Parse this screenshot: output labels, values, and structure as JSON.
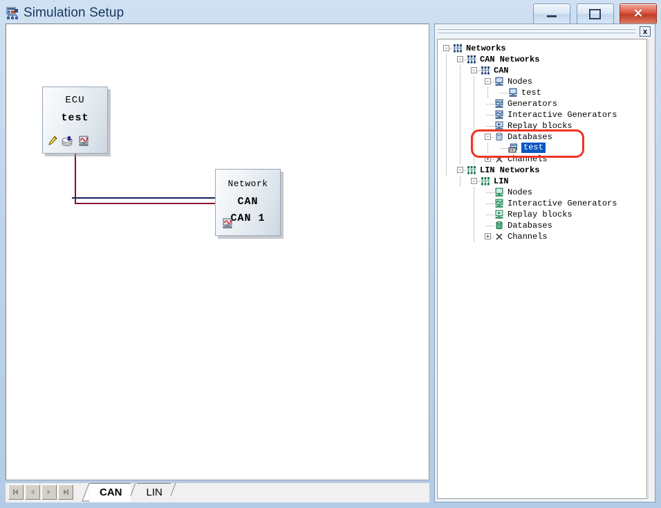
{
  "window": {
    "title": "Simulation Setup",
    "icon": "simulation-setup-icon",
    "minimize_label": "Minimize",
    "maximize_label": "Maximize",
    "close_label": "✕"
  },
  "canvas": {
    "blocks": [
      {
        "kind": "ecu",
        "line1": "ECU",
        "line2": "test",
        "icons": [
          "pencil-icon",
          "stack-icon",
          "measurement-icon"
        ]
      },
      {
        "kind": "network",
        "line1": "Network",
        "line2": "CAN",
        "line3": "CAN 1",
        "icons": [
          "measurement-icon"
        ]
      }
    ],
    "wire_colors": {
      "bus": "#8c0a33",
      "signal": "#11225e"
    }
  },
  "tabstrip": {
    "nav_buttons": [
      "first-record-button",
      "previous-record-button",
      "next-record-button",
      "last-record-button"
    ],
    "tabs": [
      {
        "label": "CAN",
        "active": true
      },
      {
        "label": "LIN",
        "active": false
      }
    ]
  },
  "dock": {
    "close_label": "x",
    "scrollbar": "vertical-scrollbar",
    "tree": [
      {
        "label": "Networks",
        "depth": 0,
        "expander": "-",
        "icon": "network-icon",
        "bold": true,
        "selected": false
      },
      {
        "label": "CAN Networks",
        "depth": 1,
        "expander": "-",
        "icon": "network-icon",
        "bold": true,
        "selected": false
      },
      {
        "label": "CAN",
        "depth": 2,
        "expander": "-",
        "icon": "network-icon",
        "bold": true,
        "selected": false
      },
      {
        "label": "Nodes",
        "depth": 3,
        "expander": "-",
        "icon": "node-icon",
        "bold": false,
        "selected": false
      },
      {
        "label": "test",
        "depth": 4,
        "expander": "",
        "icon": "node-icon",
        "bold": false,
        "selected": false
      },
      {
        "label": "Generators",
        "depth": 3,
        "expander": "",
        "icon": "generator-icon",
        "bold": false,
        "selected": false
      },
      {
        "label": "Interactive Generators",
        "depth": 3,
        "expander": "",
        "icon": "generator-icon",
        "bold": false,
        "selected": false
      },
      {
        "label": "Replay blocks",
        "depth": 3,
        "expander": "",
        "icon": "replay-icon",
        "bold": false,
        "selected": false
      },
      {
        "label": "Databases",
        "depth": 3,
        "expander": "-",
        "icon": "database-icon",
        "bold": false,
        "selected": false
      },
      {
        "label": "test",
        "depth": 4,
        "expander": "",
        "icon": "dbc-icon",
        "bold": false,
        "selected": true
      },
      {
        "label": "Channels",
        "depth": 3,
        "expander": "+",
        "icon": "channels-icon",
        "bold": false,
        "selected": false
      },
      {
        "label": "LIN Networks",
        "depth": 1,
        "expander": "-",
        "icon": "lin-network-icon",
        "bold": true,
        "selected": false
      },
      {
        "label": "LIN",
        "depth": 2,
        "expander": "-",
        "icon": "lin-network-icon",
        "bold": true,
        "selected": false
      },
      {
        "label": "Nodes",
        "depth": 3,
        "expander": "",
        "icon": "lin-node-icon",
        "bold": false,
        "selected": false
      },
      {
        "label": "Interactive Generators",
        "depth": 3,
        "expander": "",
        "icon": "lin-generator-icon",
        "bold": false,
        "selected": false
      },
      {
        "label": "Replay blocks",
        "depth": 3,
        "expander": "",
        "icon": "lin-replay-icon",
        "bold": false,
        "selected": false
      },
      {
        "label": "Databases",
        "depth": 3,
        "expander": "",
        "icon": "lin-database-icon",
        "bold": false,
        "selected": false
      },
      {
        "label": "Channels",
        "depth": 3,
        "expander": "+",
        "icon": "channels-icon",
        "bold": false,
        "selected": false
      }
    ],
    "highlight": {
      "shape": "rounded-rectangle",
      "color": "#ee3322",
      "targets": [
        "Databases",
        "test"
      ]
    }
  }
}
